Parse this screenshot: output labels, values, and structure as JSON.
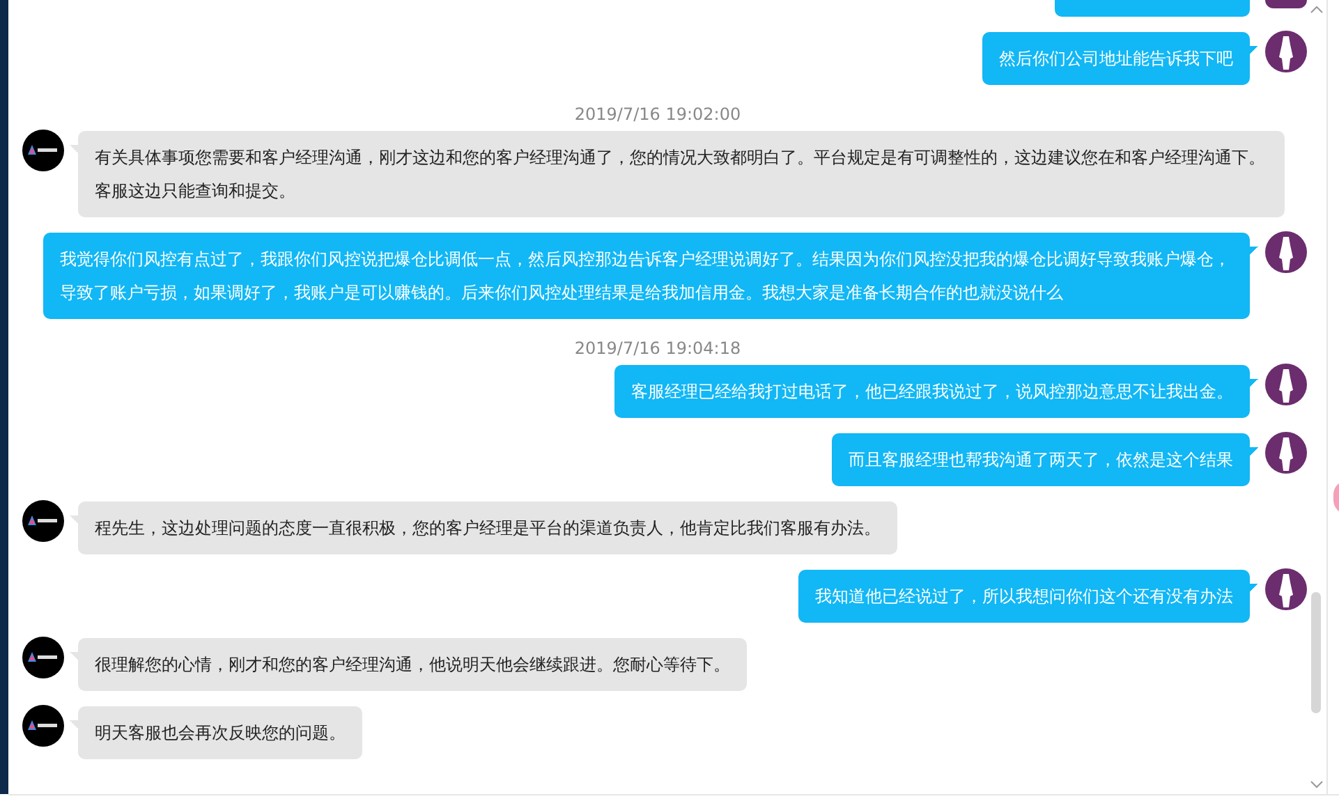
{
  "messages": [
    {
      "kind": "sent",
      "text": "然后你们公司地址能告诉我下吧"
    },
    {
      "kind": "timestamp",
      "text": "2019/7/16 19:02:00"
    },
    {
      "kind": "received",
      "text": "有关具体事项您需要和客户经理沟通，刚才这边和您的客户经理沟通了，您的情况大致都明白了。平台规定是有可调整性的，这边建议您在和客户经理沟通下。客服这边只能查询和提交。"
    },
    {
      "kind": "sent",
      "text": "我觉得你们风控有点过了，我跟你们风控说把爆仓比调低一点，然后风控那边告诉客户经理说调好了。结果因为你们风控没把我的爆仓比调好导致我账户爆仓，导致了账户亏损，如果调好了，我账户是可以赚钱的。后来你们风控处理结果是给我加信用金。我想大家是准备长期合作的也就没说什么"
    },
    {
      "kind": "timestamp",
      "text": "2019/7/16 19:04:18"
    },
    {
      "kind": "sent",
      "text": "客服经理已经给我打过电话了，他已经跟我说过了，说风控那边意思不让我出金。"
    },
    {
      "kind": "sent",
      "text": "而且客服经理也帮我沟通了两天了，依然是这个结果"
    },
    {
      "kind": "received",
      "text": "程先生，这边处理问题的态度一直很积极，您的客户经理是平台的渠道负责人，他肯定比我们客服有办法。"
    },
    {
      "kind": "sent",
      "text": "我知道他已经说过了，所以我想问你们这个还有没有办法"
    },
    {
      "kind": "received",
      "text": "很理解您的心情，刚才和您的客户经理沟通，他说明天他会继续跟进。您耐心等待下。"
    },
    {
      "kind": "received",
      "text": "明天客服也会再次反映您的问题。"
    }
  ]
}
